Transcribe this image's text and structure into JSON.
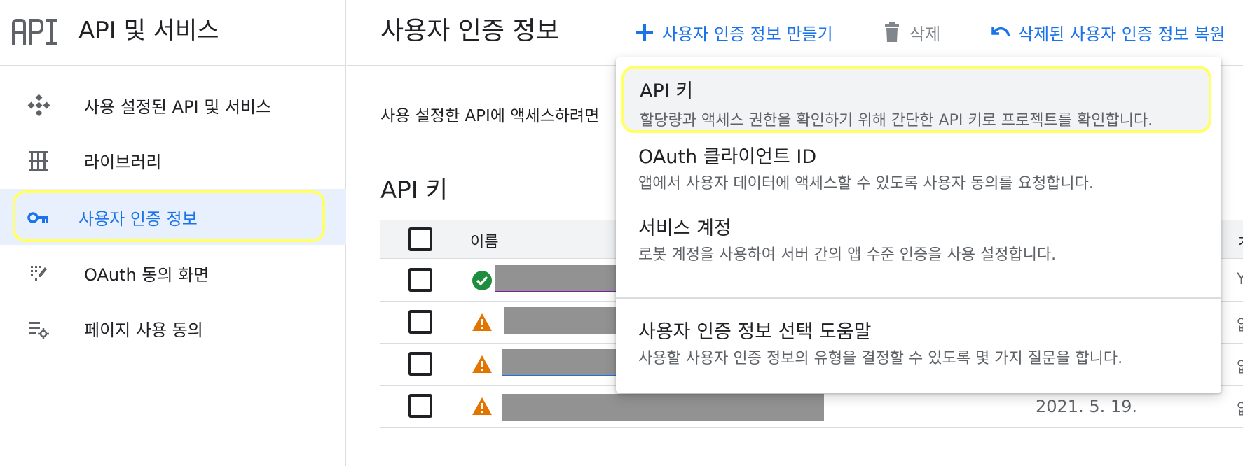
{
  "app": {
    "title": "API 및 서비스"
  },
  "sidebar": {
    "items": [
      {
        "label": "사용 설정된 API 및 서비스",
        "icon": "api-services-icon"
      },
      {
        "label": "라이브러리",
        "icon": "library-icon"
      },
      {
        "label": "사용자 인증 정보",
        "icon": "key-icon",
        "active": true
      },
      {
        "label": "OAuth 동의 화면",
        "icon": "oauth-consent-icon"
      },
      {
        "label": "페이지 사용 동의",
        "icon": "page-usage-settings-icon"
      }
    ]
  },
  "header": {
    "title": "사용자 인증 정보",
    "create_label": "사용자 인증 정보 만들기",
    "delete_label": "삭제",
    "restore_label": "삭제된 사용자 인증 정보 복원"
  },
  "main": {
    "description": "사용 설정한 API에 액세스하려면",
    "section_title": "API 키",
    "table": {
      "columns": [
        "이름"
      ],
      "rows": [
        {
          "status": "ok",
          "date": ""
        },
        {
          "status": "warning",
          "date": ""
        },
        {
          "status": "warning",
          "date": ""
        },
        {
          "status": "warning",
          "date": "2021. 5. 19."
        }
      ]
    }
  },
  "menu": {
    "items": [
      {
        "title": "API 키",
        "description": "할당량과 액세스 권한을 확인하기 위해 간단한 API 키로 프로젝트를 확인합니다."
      },
      {
        "title": "OAuth 클라이언트 ID",
        "description": "앱에서 사용자 데이터에 액세스할 수 있도록 사용자 동의를 요청합니다."
      },
      {
        "title": "서비스 계정",
        "description": "로봇 계정을 사용하여 서버 간의 앱 수준 인증을 사용 설정합니다."
      },
      {
        "title": "사용자 인증 정보 선택 도움말",
        "description": "사용할 사용자 인증 정보의 유형을 결정할 수 있도록 몇 가지 질문을 합니다."
      }
    ]
  },
  "colors": {
    "accent": "#1a73e8",
    "active_bg": "#e8f0fe",
    "highlight": "#ffff66",
    "ok": "#1e8e3e",
    "warning": "#e37400"
  }
}
